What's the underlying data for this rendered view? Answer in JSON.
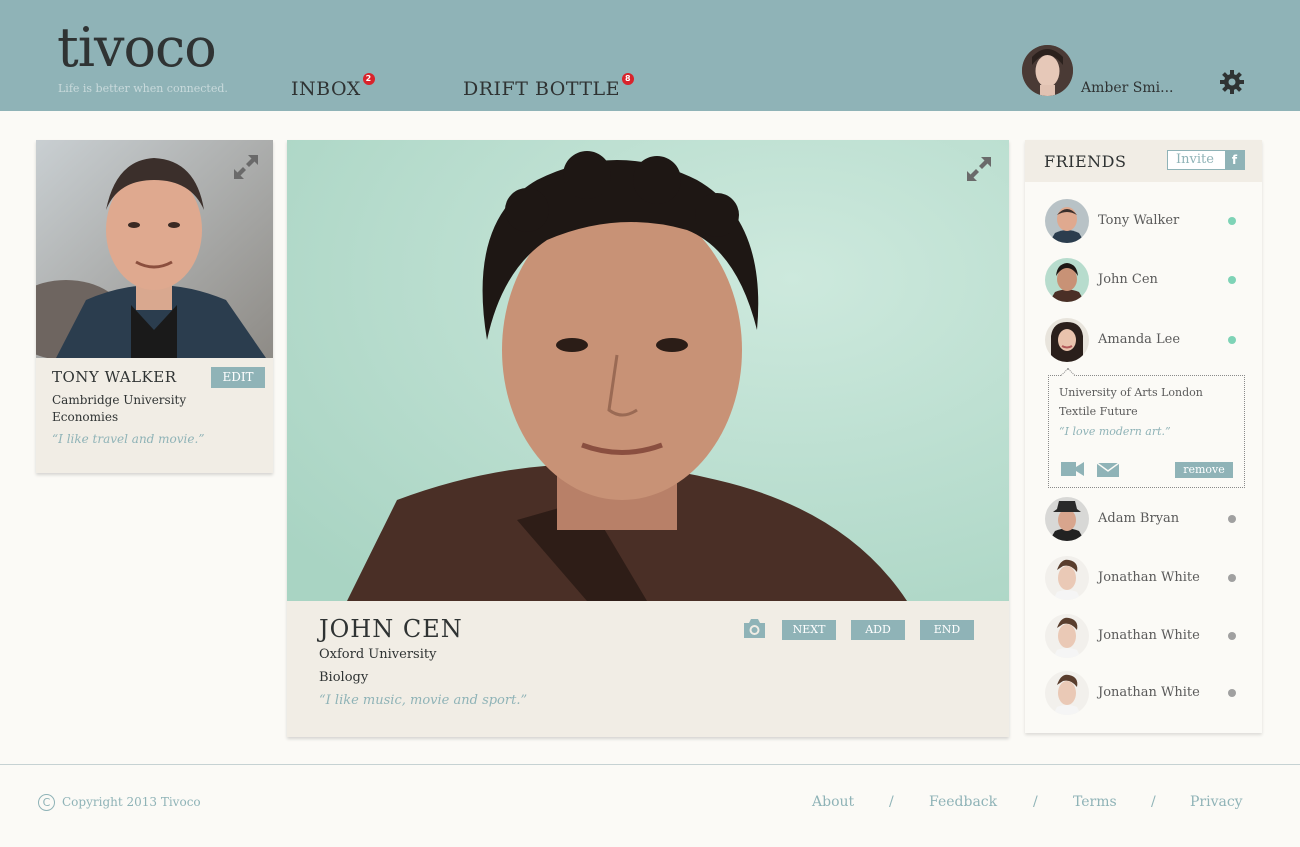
{
  "header": {
    "logo": "tivoco",
    "tagline": "Life is better when connected.",
    "nav": [
      {
        "label": "INBOX",
        "badge": "2"
      },
      {
        "label": "DRIFT BOTTLE",
        "badge": "8"
      }
    ],
    "user_name": "Amber Smi...",
    "icons": {
      "settings": "gear-icon"
    }
  },
  "profile_card": {
    "name": "TONY WALKER",
    "edit_label": "EDIT",
    "school_line1": "Cambridge University",
    "school_line2": "Economies",
    "quote": "“I like travel and movie.”"
  },
  "main_card": {
    "name": "JOHN CEN",
    "school": "Oxford University",
    "major": "Biology",
    "quote": "“I like music, movie and sport.”",
    "buttons": {
      "next": "NEXT",
      "add": "ADD",
      "end": "END"
    }
  },
  "friends": {
    "title": "FRIENDS",
    "invite_label": "Invite",
    "fb_label": "f",
    "list": [
      {
        "name": "Tony Walker",
        "online": true
      },
      {
        "name": "John Cen",
        "online": true
      },
      {
        "name": "Amanda Lee",
        "online": true
      },
      {
        "name": "Adam Bryan",
        "online": false
      },
      {
        "name": "Jonathan White",
        "online": false
      },
      {
        "name": "Jonathan White",
        "online": false
      },
      {
        "name": "Jonathan White",
        "online": false
      }
    ],
    "popover": {
      "line1": "University of Arts London",
      "line2": "Textile Future",
      "quote": "“I love modern art.”",
      "remove_label": "remove"
    }
  },
  "footer": {
    "copyright": "Copyright 2013 Tivoco",
    "links": [
      "About",
      "Feedback",
      "Terms",
      "Privacy"
    ],
    "separator": "/"
  },
  "colors": {
    "accent": "#8fb3b7",
    "online": "#7ed3b6",
    "offline": "#a0a0a0",
    "badge": "#d9232b"
  }
}
